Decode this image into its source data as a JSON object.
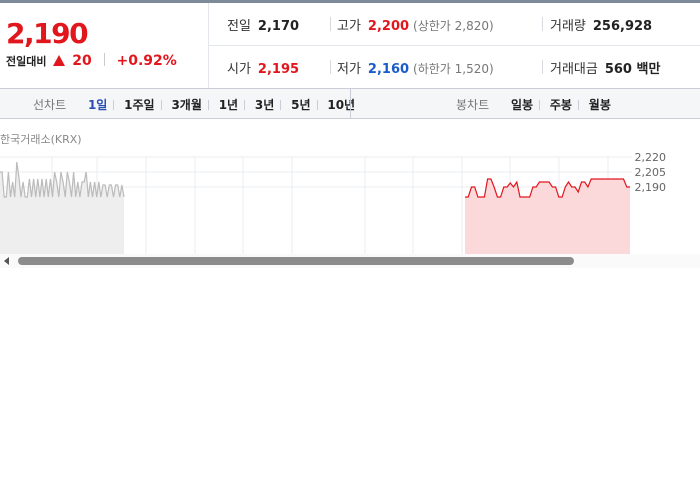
{
  "quote": {
    "current_price": "2,190",
    "change_label": "전일대비",
    "change_value": "20",
    "change_rate": "+0.92%",
    "up_color": "#e2161d",
    "down_color": "#1a5ccc"
  },
  "info": {
    "prev_close": {
      "label": "전일",
      "value": "2,170"
    },
    "high": {
      "label": "고가",
      "value": "2,200",
      "sub": "(상한가 2,820)"
    },
    "volume": {
      "label": "거래량",
      "value": "256,928"
    },
    "open": {
      "label": "시가",
      "value": "2,195"
    },
    "low": {
      "label": "저가",
      "value": "2,160",
      "sub": "(하한가 1,520)"
    },
    "amount": {
      "label": "거래대금",
      "value": "560 백만"
    }
  },
  "line_tabs": {
    "label": "선차트",
    "items": [
      "1일",
      "1주일",
      "3개월",
      "1년",
      "3년",
      "5년",
      "10년"
    ],
    "selected": "1일"
  },
  "candle_tabs": {
    "label": "봉차트",
    "items": [
      "일봉",
      "주봉",
      "월봉"
    ]
  },
  "chart": {
    "source": "한국거래소(KRX)",
    "y_ticks": [
      "2,220",
      "2,205",
      "2,190"
    ]
  },
  "chart_data": {
    "type": "line",
    "y_ticks": [
      2220,
      2205,
      2190
    ],
    "grid": true,
    "prev_close": 2170,
    "series": [
      {
        "color": "#bbbbbb",
        "values": [
          2205,
          2205,
          2180,
          2180,
          2205,
          2180,
          2195,
          2180,
          2215,
          2200,
          2180,
          2195,
          2180,
          2180,
          2198,
          2180,
          2198,
          2180,
          2198,
          2180,
          2198,
          2180,
          2198,
          2180,
          2198,
          2180,
          2205,
          2195,
          2180,
          2205,
          2195,
          2180,
          2205,
          2195,
          2180,
          2205,
          2180,
          2195,
          2180,
          2195,
          2195,
          2205,
          2180,
          2195,
          2180,
          2195,
          2180,
          2195,
          2180,
          2192,
          2192,
          2180,
          2192,
          2192,
          2180,
          2192,
          2192,
          2180,
          2192,
          2180
        ]
      },
      {
        "color": "#e2161d",
        "values": [
          2180,
          2180,
          2190,
          2190,
          2180,
          2180,
          2180,
          2198,
          2198,
          2190,
          2180,
          2180,
          2190,
          2190,
          2194,
          2190,
          2195,
          2180,
          2180,
          2180,
          2180,
          2190,
          2190,
          2195,
          2195,
          2195,
          2195,
          2190,
          2190,
          2180,
          2180,
          2190,
          2195,
          2190,
          2190,
          2185,
          2195,
          2195,
          2190,
          2198,
          2198,
          2198,
          2198,
          2198,
          2198,
          2198,
          2198,
          2198,
          2198,
          2198,
          2190,
          2190
        ]
      }
    ]
  }
}
